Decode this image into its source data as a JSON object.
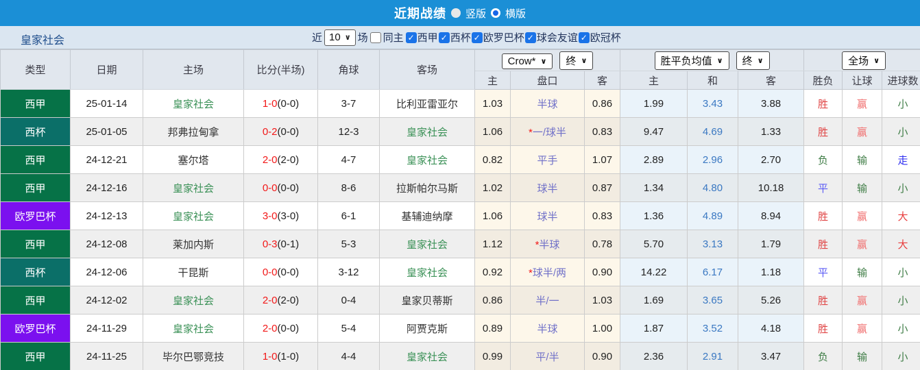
{
  "topbar": {
    "title": "近期战绩",
    "radios": [
      {
        "label": "竖版",
        "checked": false
      },
      {
        "label": "横版",
        "checked": true
      }
    ],
    "bar_color": "#1b8fd6"
  },
  "filterbar": {
    "team": "皇家社会",
    "near_label": "近",
    "count_value": "10",
    "matches_label": "场",
    "same_home_label": "同主",
    "same_home_checked": false,
    "leagues": [
      "西甲",
      "西杯",
      "欧罗巴杯",
      "球会友谊",
      "欧冠杯"
    ]
  },
  "table": {
    "controls": {
      "crow_select": "Crow*",
      "crow_final_select": "终",
      "avg_select": "胜平负均值",
      "avg_final_select": "终",
      "scope_select": "全场"
    },
    "headers": {
      "type": "类型",
      "date": "日期",
      "home": "主场",
      "score": "比分(半场)",
      "corner": "角球",
      "away": "客场",
      "sub": [
        "主",
        "盘口",
        "客",
        "主",
        "和",
        "客",
        "胜负",
        "让球",
        "进球数"
      ]
    },
    "league_colors": {
      "西甲": "#067247",
      "西杯": "#0b6f68",
      "欧罗巴杯": "#7b10ef"
    },
    "outcome_colors": {
      "胜": "#e04545",
      "负": "#3f7d46",
      "平": "#5b5bf5",
      "赢": "#f07070",
      "输": "#3f7d46",
      "走": "#2e2ef0",
      "大": "#e83c3c",
      "小": "#3f7d46"
    },
    "rows": [
      {
        "league": "西甲",
        "date": "25-01-14",
        "home": "皇家社会",
        "score": "1-0",
        "half": "(0-0)",
        "corner": "3-7",
        "away": "比利亚雷亚尔",
        "o1": "1.03",
        "star": false,
        "hcap": "半球",
        "o2": "0.86",
        "a1": "1.99",
        "a2": "3.43",
        "a3": "3.88",
        "r": "胜",
        "s": "赢",
        "g": "小"
      },
      {
        "league": "西杯",
        "date": "25-01-05",
        "home": "邦弗拉甸拿",
        "score": "0-2",
        "half": "(0-0)",
        "corner": "12-3",
        "away": "皇家社会",
        "o1": "1.06",
        "star": true,
        "hcap": "一/球半",
        "o2": "0.83",
        "a1": "9.47",
        "a2": "4.69",
        "a3": "1.33",
        "r": "胜",
        "s": "赢",
        "g": "小"
      },
      {
        "league": "西甲",
        "date": "24-12-21",
        "home": "塞尔塔",
        "score": "2-0",
        "half": "(2-0)",
        "corner": "4-7",
        "away": "皇家社会",
        "o1": "0.82",
        "star": false,
        "hcap": "平手",
        "o2": "1.07",
        "a1": "2.89",
        "a2": "2.96",
        "a3": "2.70",
        "r": "负",
        "s": "输",
        "g": "走"
      },
      {
        "league": "西甲",
        "date": "24-12-16",
        "home": "皇家社会",
        "score": "0-0",
        "half": "(0-0)",
        "corner": "8-6",
        "away": "拉斯帕尔马斯",
        "o1": "1.02",
        "star": false,
        "hcap": "球半",
        "o2": "0.87",
        "a1": "1.34",
        "a2": "4.80",
        "a3": "10.18",
        "r": "平",
        "s": "输",
        "g": "小"
      },
      {
        "league": "欧罗巴杯",
        "date": "24-12-13",
        "home": "皇家社会",
        "score": "3-0",
        "half": "(3-0)",
        "corner": "6-1",
        "away": "基辅迪纳摩",
        "o1": "1.06",
        "star": false,
        "hcap": "球半",
        "o2": "0.83",
        "a1": "1.36",
        "a2": "4.89",
        "a3": "8.94",
        "r": "胜",
        "s": "赢",
        "g": "大"
      },
      {
        "league": "西甲",
        "date": "24-12-08",
        "home": "莱加内斯",
        "score": "0-3",
        "half": "(0-1)",
        "corner": "5-3",
        "away": "皇家社会",
        "o1": "1.12",
        "star": true,
        "hcap": "半球",
        "o2": "0.78",
        "a1": "5.70",
        "a2": "3.13",
        "a3": "1.79",
        "r": "胜",
        "s": "赢",
        "g": "大"
      },
      {
        "league": "西杯",
        "date": "24-12-06",
        "home": "干昆斯",
        "score": "0-0",
        "half": "(0-0)",
        "corner": "3-12",
        "away": "皇家社会",
        "o1": "0.92",
        "star": true,
        "hcap": "球半/两",
        "o2": "0.90",
        "a1": "14.22",
        "a2": "6.17",
        "a3": "1.18",
        "r": "平",
        "s": "输",
        "g": "小"
      },
      {
        "league": "西甲",
        "date": "24-12-02",
        "home": "皇家社会",
        "score": "2-0",
        "half": "(2-0)",
        "corner": "0-4",
        "away": "皇家贝蒂斯",
        "o1": "0.86",
        "star": false,
        "hcap": "半/一",
        "o2": "1.03",
        "a1": "1.69",
        "a2": "3.65",
        "a3": "5.26",
        "r": "胜",
        "s": "赢",
        "g": "小"
      },
      {
        "league": "欧罗巴杯",
        "date": "24-11-29",
        "home": "皇家社会",
        "score": "2-0",
        "half": "(0-0)",
        "corner": "5-4",
        "away": "阿贾克斯",
        "o1": "0.89",
        "star": false,
        "hcap": "半球",
        "o2": "1.00",
        "a1": "1.87",
        "a2": "3.52",
        "a3": "4.18",
        "r": "胜",
        "s": "赢",
        "g": "小"
      },
      {
        "league": "西甲",
        "date": "24-11-25",
        "home": "毕尔巴鄂竞技",
        "score": "1-0",
        "half": "(1-0)",
        "corner": "4-4",
        "away": "皇家社会",
        "o1": "0.99",
        "star": false,
        "hcap": "平/半",
        "o2": "0.90",
        "a1": "2.36",
        "a2": "2.91",
        "a3": "3.47",
        "r": "负",
        "s": "输",
        "g": "小"
      }
    ]
  }
}
